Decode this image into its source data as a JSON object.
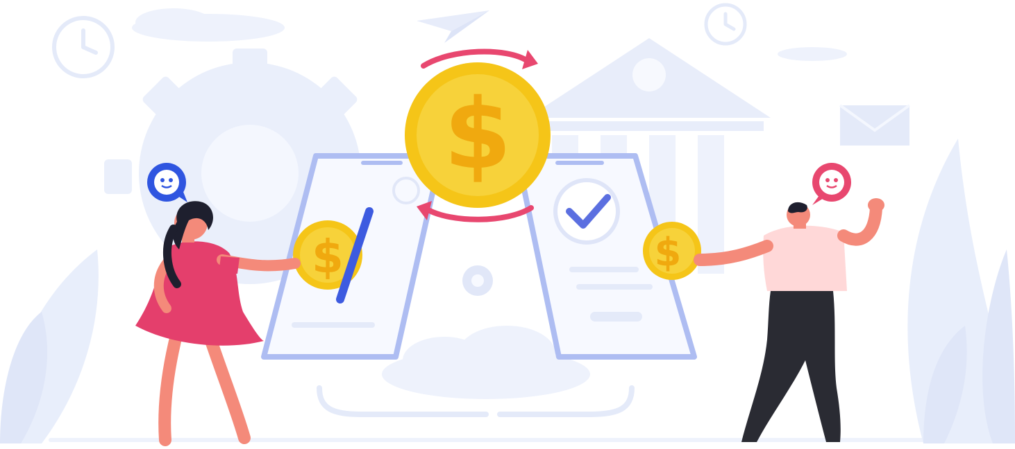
{
  "illustration": {
    "subject": "money-transfer",
    "palette": {
      "background": "#ffffff",
      "bg_shapes": "#e9eefb",
      "bg_shapes_dark": "#dde5f8",
      "phone_frame": "#aebdf2",
      "phone_screen": "#f7f9ff",
      "coin_outer": "#f5c518",
      "coin_inner": "#f7d23a",
      "coin_symbol": "#f0a90f",
      "arrow": "#e8476f",
      "check": "#5b6fe0",
      "pen": "#3d5be0",
      "woman_dress": "#e43f6c",
      "skin": "#f48a7a",
      "hair": "#1e1f2e",
      "man_shirt": "#ffd8d8",
      "man_pants": "#2a2b33",
      "bubble_blue": "#2f55e0",
      "bubble_pink": "#e8476f"
    },
    "icons": [
      "clock-icon",
      "paper-plane-icon",
      "gear-icon",
      "bank-icon",
      "envelope-icon",
      "cloud-icon",
      "check-icon",
      "dollar-coin-icon",
      "refresh-arrows-icon",
      "chat-bubble-icon",
      "pen-icon"
    ],
    "coin_symbol": "$"
  }
}
